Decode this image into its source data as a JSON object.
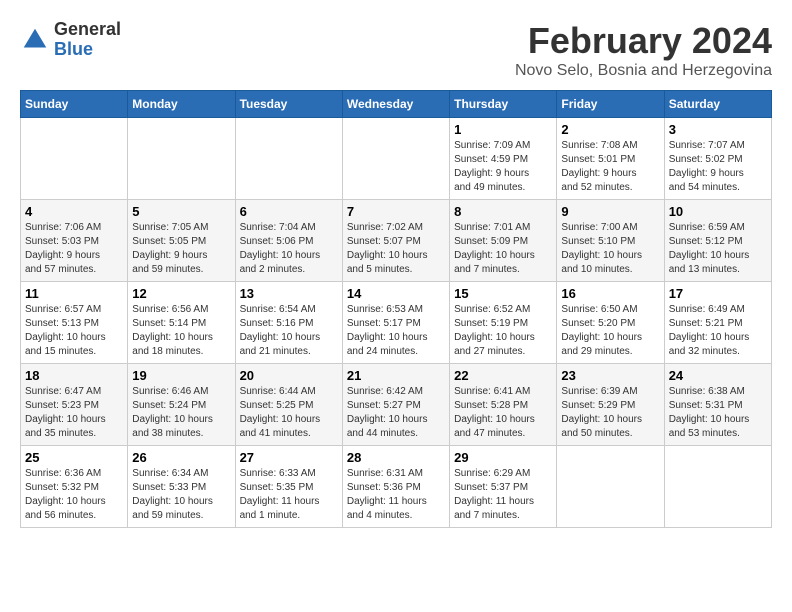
{
  "header": {
    "logo": {
      "general": "General",
      "blue": "Blue"
    },
    "title": "February 2024",
    "subtitle": "Novo Selo, Bosnia and Herzegovina"
  },
  "calendar": {
    "days_of_week": [
      "Sunday",
      "Monday",
      "Tuesday",
      "Wednesday",
      "Thursday",
      "Friday",
      "Saturday"
    ],
    "weeks": [
      [
        {
          "day": "",
          "info": ""
        },
        {
          "day": "",
          "info": ""
        },
        {
          "day": "",
          "info": ""
        },
        {
          "day": "",
          "info": ""
        },
        {
          "day": "1",
          "info": "Sunrise: 7:09 AM\nSunset: 4:59 PM\nDaylight: 9 hours\nand 49 minutes."
        },
        {
          "day": "2",
          "info": "Sunrise: 7:08 AM\nSunset: 5:01 PM\nDaylight: 9 hours\nand 52 minutes."
        },
        {
          "day": "3",
          "info": "Sunrise: 7:07 AM\nSunset: 5:02 PM\nDaylight: 9 hours\nand 54 minutes."
        }
      ],
      [
        {
          "day": "4",
          "info": "Sunrise: 7:06 AM\nSunset: 5:03 PM\nDaylight: 9 hours\nand 57 minutes."
        },
        {
          "day": "5",
          "info": "Sunrise: 7:05 AM\nSunset: 5:05 PM\nDaylight: 9 hours\nand 59 minutes."
        },
        {
          "day": "6",
          "info": "Sunrise: 7:04 AM\nSunset: 5:06 PM\nDaylight: 10 hours\nand 2 minutes."
        },
        {
          "day": "7",
          "info": "Sunrise: 7:02 AM\nSunset: 5:07 PM\nDaylight: 10 hours\nand 5 minutes."
        },
        {
          "day": "8",
          "info": "Sunrise: 7:01 AM\nSunset: 5:09 PM\nDaylight: 10 hours\nand 7 minutes."
        },
        {
          "day": "9",
          "info": "Sunrise: 7:00 AM\nSunset: 5:10 PM\nDaylight: 10 hours\nand 10 minutes."
        },
        {
          "day": "10",
          "info": "Sunrise: 6:59 AM\nSunset: 5:12 PM\nDaylight: 10 hours\nand 13 minutes."
        }
      ],
      [
        {
          "day": "11",
          "info": "Sunrise: 6:57 AM\nSunset: 5:13 PM\nDaylight: 10 hours\nand 15 minutes."
        },
        {
          "day": "12",
          "info": "Sunrise: 6:56 AM\nSunset: 5:14 PM\nDaylight: 10 hours\nand 18 minutes."
        },
        {
          "day": "13",
          "info": "Sunrise: 6:54 AM\nSunset: 5:16 PM\nDaylight: 10 hours\nand 21 minutes."
        },
        {
          "day": "14",
          "info": "Sunrise: 6:53 AM\nSunset: 5:17 PM\nDaylight: 10 hours\nand 24 minutes."
        },
        {
          "day": "15",
          "info": "Sunrise: 6:52 AM\nSunset: 5:19 PM\nDaylight: 10 hours\nand 27 minutes."
        },
        {
          "day": "16",
          "info": "Sunrise: 6:50 AM\nSunset: 5:20 PM\nDaylight: 10 hours\nand 29 minutes."
        },
        {
          "day": "17",
          "info": "Sunrise: 6:49 AM\nSunset: 5:21 PM\nDaylight: 10 hours\nand 32 minutes."
        }
      ],
      [
        {
          "day": "18",
          "info": "Sunrise: 6:47 AM\nSunset: 5:23 PM\nDaylight: 10 hours\nand 35 minutes."
        },
        {
          "day": "19",
          "info": "Sunrise: 6:46 AM\nSunset: 5:24 PM\nDaylight: 10 hours\nand 38 minutes."
        },
        {
          "day": "20",
          "info": "Sunrise: 6:44 AM\nSunset: 5:25 PM\nDaylight: 10 hours\nand 41 minutes."
        },
        {
          "day": "21",
          "info": "Sunrise: 6:42 AM\nSunset: 5:27 PM\nDaylight: 10 hours\nand 44 minutes."
        },
        {
          "day": "22",
          "info": "Sunrise: 6:41 AM\nSunset: 5:28 PM\nDaylight: 10 hours\nand 47 minutes."
        },
        {
          "day": "23",
          "info": "Sunrise: 6:39 AM\nSunset: 5:29 PM\nDaylight: 10 hours\nand 50 minutes."
        },
        {
          "day": "24",
          "info": "Sunrise: 6:38 AM\nSunset: 5:31 PM\nDaylight: 10 hours\nand 53 minutes."
        }
      ],
      [
        {
          "day": "25",
          "info": "Sunrise: 6:36 AM\nSunset: 5:32 PM\nDaylight: 10 hours\nand 56 minutes."
        },
        {
          "day": "26",
          "info": "Sunrise: 6:34 AM\nSunset: 5:33 PM\nDaylight: 10 hours\nand 59 minutes."
        },
        {
          "day": "27",
          "info": "Sunrise: 6:33 AM\nSunset: 5:35 PM\nDaylight: 11 hours\nand 1 minute."
        },
        {
          "day": "28",
          "info": "Sunrise: 6:31 AM\nSunset: 5:36 PM\nDaylight: 11 hours\nand 4 minutes."
        },
        {
          "day": "29",
          "info": "Sunrise: 6:29 AM\nSunset: 5:37 PM\nDaylight: 11 hours\nand 7 minutes."
        },
        {
          "day": "",
          "info": ""
        },
        {
          "day": "",
          "info": ""
        }
      ]
    ]
  }
}
